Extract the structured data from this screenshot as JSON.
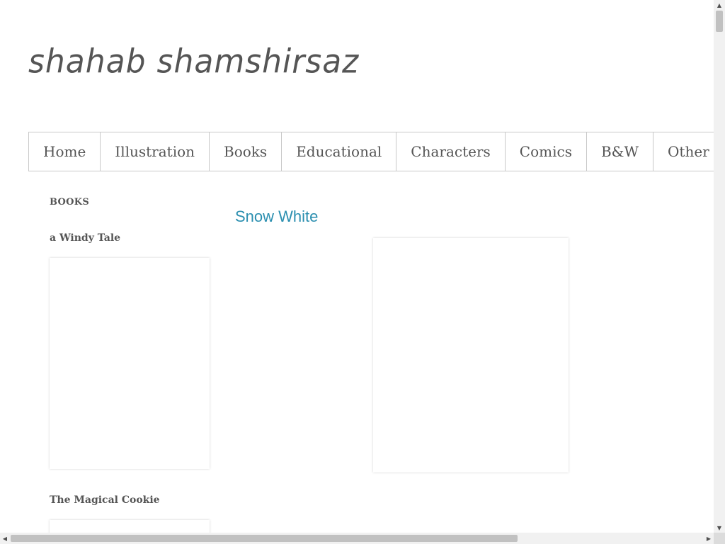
{
  "site": {
    "title": "shahab shamshirsaz"
  },
  "nav": {
    "items": [
      {
        "label": "Home"
      },
      {
        "label": "Illustration"
      },
      {
        "label": "Books"
      },
      {
        "label": "Educational"
      },
      {
        "label": "Characters"
      },
      {
        "label": "Comics"
      },
      {
        "label": "B&W"
      },
      {
        "label": "Other"
      }
    ]
  },
  "sidebar": {
    "heading": "BOOKS",
    "books": [
      {
        "title": "a Windy Tale"
      },
      {
        "title": "The Magical Cookie"
      }
    ]
  },
  "post": {
    "title": "Snow White",
    "title_color": "#2b8fb0"
  },
  "scrollbars": {
    "up_arrow_icon": "▲",
    "down_arrow_icon": "▼",
    "left_arrow_icon": "◀",
    "right_arrow_icon": "▶"
  }
}
